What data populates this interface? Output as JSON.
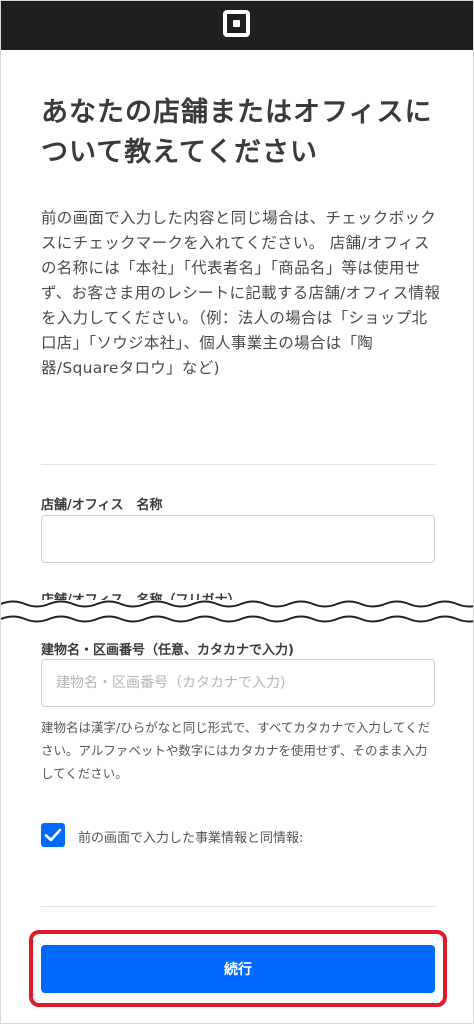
{
  "header": {
    "logo_icon": "square-logo-icon",
    "background": "#1f1f1f"
  },
  "page": {
    "title": "あなたの店舗またはオフィスについて教えてください",
    "description": "前の画面で入力した内容と同じ場合は、チェックボックスにチェックマークを入れてください。 店舗/オフィスの名称には「本社」「代表者名」「商品名」等は使用せず、お客さま用のレシートに記載する店舗/オフィス情報を入力してください。（例：法人の場合は「ショップ北口店」「ソウジ本社」、個人事業主の場合は「陶器/Squareタロウ」など)"
  },
  "form": {
    "store_name": {
      "label": "店舗/オフィス　名称",
      "value": "",
      "placeholder": ""
    },
    "store_name_kana": {
      "label": "店舗/オフィス　名称（フリガナ）"
    },
    "building": {
      "label": "建物名・区画番号（任意、カタカナで入力)",
      "placeholder": "建物名・区画番号（カタカナで入力)",
      "helper": "建物名は漢字/ひらがなと同じ形式で、すべてカタカナで入力してください。アルファベットや数字にはカタカナを使用せず、そのまま入力してください。"
    },
    "same_info_checkbox": {
      "label": "前の画面で入力した事業情報と同情報:",
      "checked": true
    }
  },
  "actions": {
    "continue_label": "続行"
  },
  "colors": {
    "accent": "#006aff",
    "highlight": "#e0192b"
  }
}
